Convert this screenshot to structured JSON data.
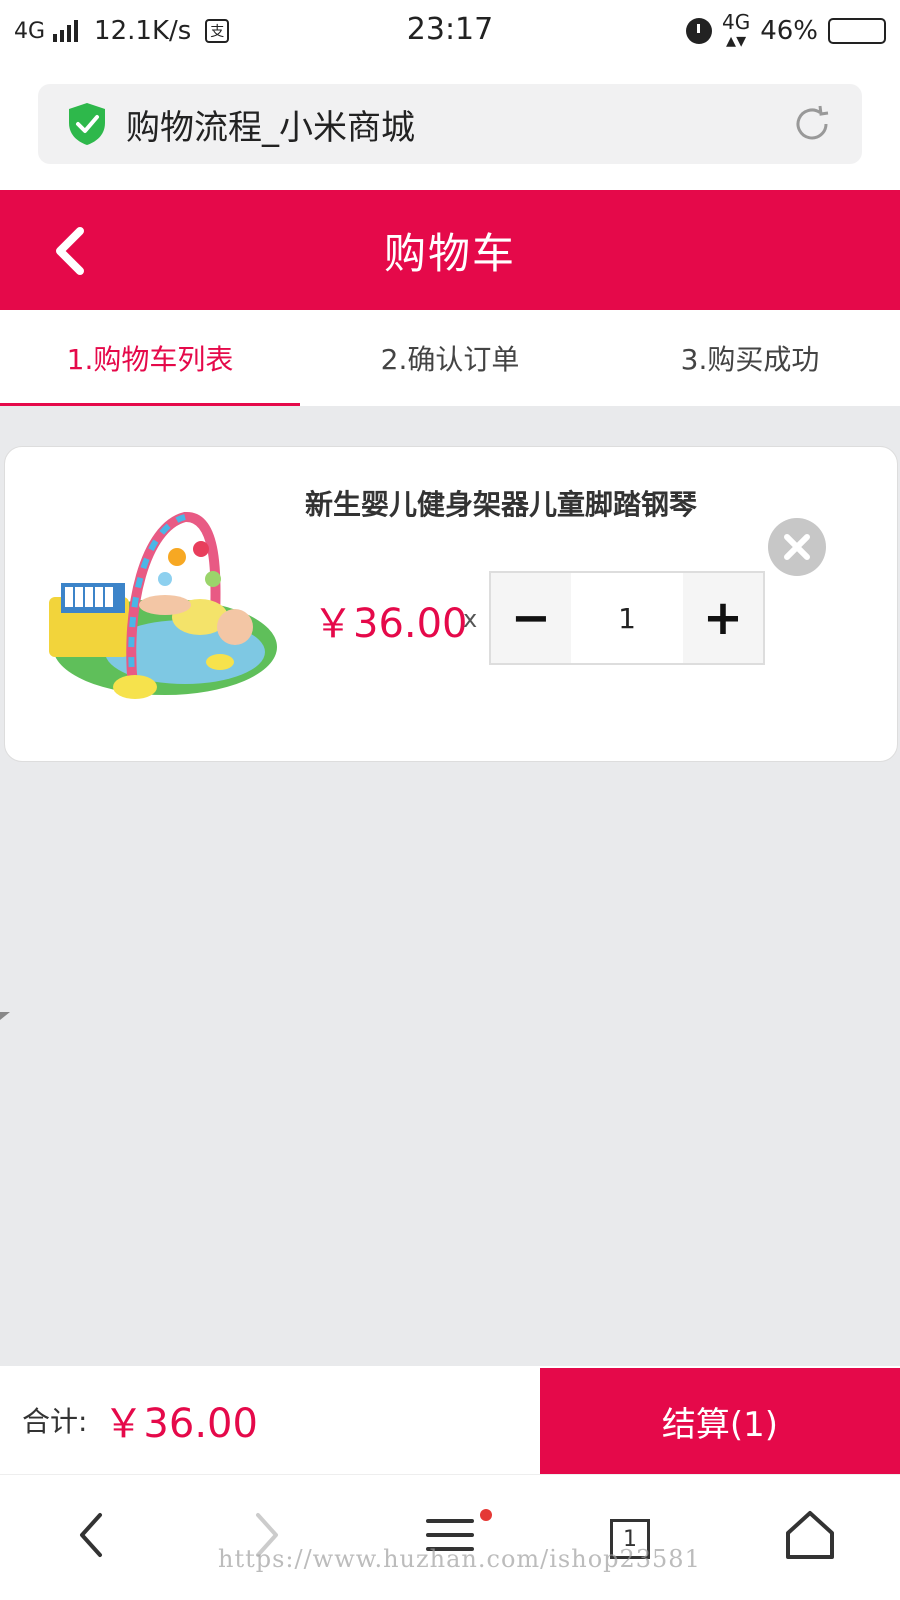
{
  "status_bar": {
    "network": "4G",
    "speed": "12.1K/s",
    "time": "23:17",
    "network_right": "4G",
    "battery": "46%"
  },
  "browser": {
    "page_title": "购物流程_小米商城"
  },
  "header": {
    "title": "购物车"
  },
  "steps": [
    {
      "label": "1.购物车列表",
      "active": true
    },
    {
      "label": "2.确认订单",
      "active": false
    },
    {
      "label": "3.购买成功",
      "active": false
    }
  ],
  "cart": {
    "items": [
      {
        "name": "新生婴儿健身架器儿童脚踏钢琴",
        "price": "￥36.00",
        "times": "x",
        "quantity": "1",
        "minus": "−",
        "plus": "+"
      }
    ]
  },
  "checkout": {
    "total_label": "合计:",
    "total_value": "￥36.00",
    "button_label": "结算(1)"
  },
  "bottom_nav": {
    "tab_count": "1",
    "watermark": "https://www.huzhan.com/ishop23581"
  },
  "colors": {
    "accent": "#e5094a",
    "background": "#e9eaec"
  },
  "battery_level": 0.46
}
